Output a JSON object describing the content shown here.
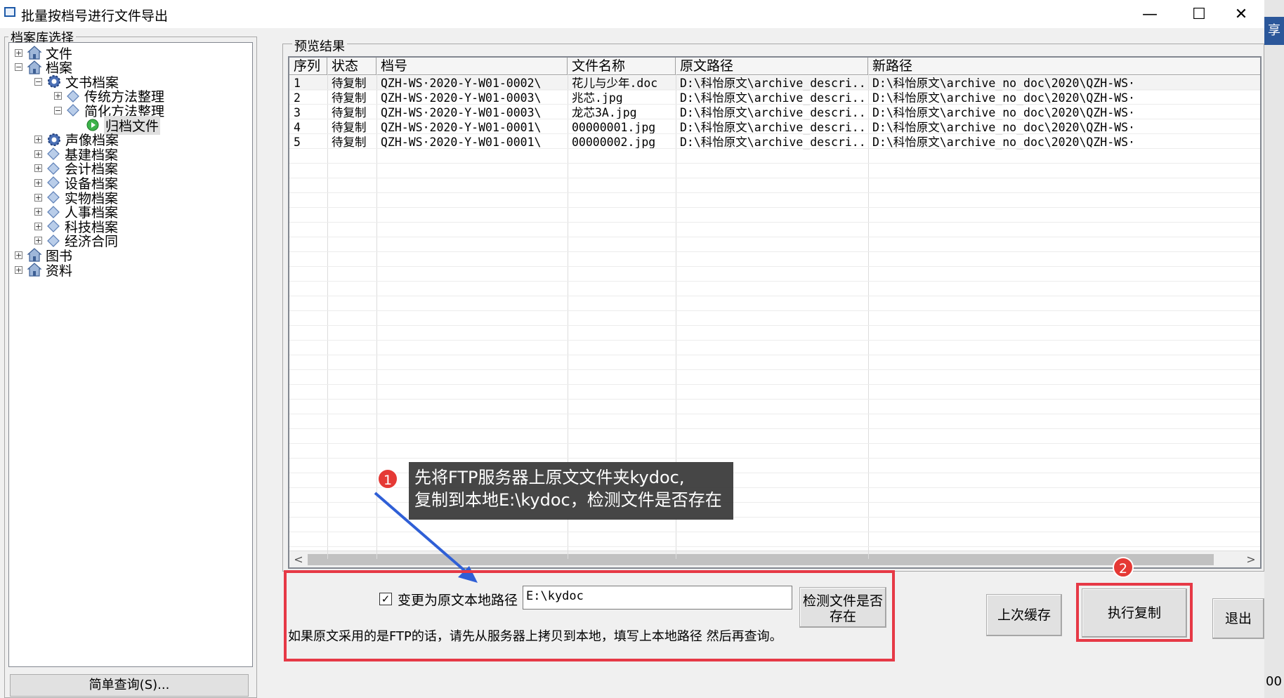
{
  "window": {
    "title": "批量按档号进行文件导出",
    "minimize": "—",
    "maximize": "☐",
    "close": "✕"
  },
  "side_strip": {
    "tab_text": "享",
    "bottom_text": "00"
  },
  "left_panel": {
    "legend": "档案库选择",
    "tree": [
      {
        "label": "文件",
        "level": 0,
        "expander": "+",
        "icon": "house-icon"
      },
      {
        "label": "档案",
        "level": 0,
        "expander": "−",
        "icon": "house-icon"
      },
      {
        "label": "文书档案",
        "level": 1,
        "expander": "−",
        "icon": "gear-icon"
      },
      {
        "label": "传统方法整理",
        "level": 2,
        "expander": "+",
        "icon": "diamond-icon"
      },
      {
        "label": "简化方法整理",
        "level": 2,
        "expander": "−",
        "icon": "diamond-icon"
      },
      {
        "label": "归档文件",
        "level": 3,
        "expander": "",
        "icon": "play-icon"
      },
      {
        "label": "声像档案",
        "level": 1,
        "expander": "+",
        "icon": "gear-icon"
      },
      {
        "label": "基建档案",
        "level": 1,
        "expander": "+",
        "icon": "diamond-icon"
      },
      {
        "label": "会计档案",
        "level": 1,
        "expander": "+",
        "icon": "diamond-icon"
      },
      {
        "label": "设备档案",
        "level": 1,
        "expander": "+",
        "icon": "diamond-icon"
      },
      {
        "label": "实物档案",
        "level": 1,
        "expander": "+",
        "icon": "diamond-icon"
      },
      {
        "label": "人事档案",
        "level": 1,
        "expander": "+",
        "icon": "diamond-icon"
      },
      {
        "label": "科技档案",
        "level": 1,
        "expander": "+",
        "icon": "diamond-icon"
      },
      {
        "label": "经济合同",
        "level": 1,
        "expander": "+",
        "icon": "diamond-icon"
      },
      {
        "label": "图书",
        "level": 0,
        "expander": "+",
        "icon": "house-icon"
      },
      {
        "label": "资料",
        "level": 0,
        "expander": "+",
        "icon": "house-icon"
      }
    ],
    "simple_query_button": "简单查询(S)..."
  },
  "preview": {
    "legend": "预览结果",
    "columns": [
      "序列",
      "状态",
      "档号",
      "文件名称",
      "原文路径",
      "新路径"
    ],
    "rows": [
      [
        "1",
        "待复制",
        "QZH-WS·2020-Y-W01-0002\\",
        "花儿与少年.doc",
        "D:\\科怡原文\\archive_descri...",
        "D:\\科怡原文\\archive_no_doc\\2020\\QZH-WS·"
      ],
      [
        "2",
        "待复制",
        "QZH-WS·2020-Y-W01-0003\\",
        "兆芯.jpg",
        "D:\\科怡原文\\archive_descri...",
        "D:\\科怡原文\\archive_no_doc\\2020\\QZH-WS·"
      ],
      [
        "3",
        "待复制",
        "QZH-WS·2020-Y-W01-0003\\",
        "龙芯3A.jpg",
        "D:\\科怡原文\\archive_descri...",
        "D:\\科怡原文\\archive_no_doc\\2020\\QZH-WS·"
      ],
      [
        "4",
        "待复制",
        "QZH-WS·2020-Y-W01-0001\\",
        "00000001.jpg",
        "D:\\科怡原文\\archive_descri...",
        "D:\\科怡原文\\archive_no_doc\\2020\\QZH-WS·"
      ],
      [
        "5",
        "待复制",
        "QZH-WS·2020-Y-W01-0001\\",
        "00000002.jpg",
        "D:\\科怡原文\\archive_descri...",
        "D:\\科怡原文\\archive_no_doc\\2020\\QZH-WS·"
      ]
    ],
    "scroll_left": "<",
    "scroll_right": ">"
  },
  "annotation": {
    "badge1": "1",
    "text_line1": "先将FTP服务器上原文文件夹kydoc,",
    "text_line2": "复制到本地E:\\kydoc，检测文件是否存在",
    "badge2": "2"
  },
  "controls": {
    "checkbox_checked": "✓",
    "checkbox_label": "变更为原文本地路径",
    "local_path_value": "E:\\kydoc",
    "check_button_line1": "检测文件是否",
    "check_button_line2": "存在",
    "hint": "如果原文采用的是FTP的话，请先从服务器上拷贝到本地，填写上本地路径 然后再查询。",
    "last_cache_button": "上次缓存",
    "execute_copy_button": "执行复制",
    "exit_button": "退出"
  },
  "colors": {
    "annotation_red": "#e63946",
    "arrow_blue": "#2f5fd6",
    "callout_bg": "#3c3c3c"
  }
}
